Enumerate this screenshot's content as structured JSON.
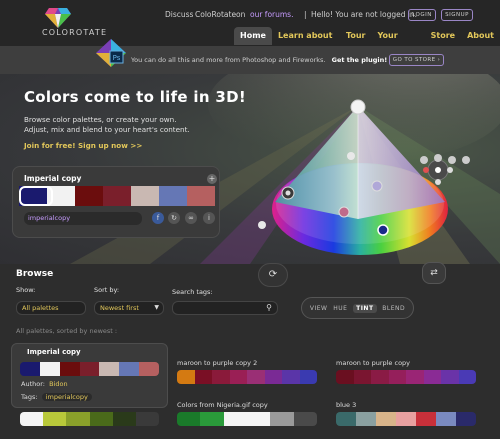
{
  "brand": {
    "logo_text": "COLOROTATE"
  },
  "header": {
    "discuss_prefix": "Discuss",
    "app_name": "ColoRotate",
    "on": "on",
    "forums_link": "our forums.",
    "greeting": "Hello! You are not logged in.",
    "login_label": "LOGIN",
    "signup_label": "SIGNUP"
  },
  "nav": {
    "tabs": [
      {
        "label": "Home",
        "active": true
      },
      {
        "label": "Learn about color",
        "active": false
      },
      {
        "label": "Tour",
        "active": false
      },
      {
        "label": "Your account",
        "active": false
      },
      {
        "label": "Store",
        "active": false
      },
      {
        "label": "About",
        "active": false
      }
    ]
  },
  "plugin_bar": {
    "text": "You can do all this and more from Photoshop and Fireworks.",
    "cta": "Get the plugin!",
    "store_button": "GO TO STORE",
    "icon_label": "Ps"
  },
  "hero": {
    "title": "Colors come to life in 3D!",
    "line1": "Browse color palettes, or create your own.",
    "line2": "Adjust, mix and blend to your heart's content.",
    "join_link": "Join for free! Sign up now >>"
  },
  "active_palette": {
    "name": "Imperial copy",
    "tag": "imperialcopy",
    "colors": [
      "#1a1a6e",
      "#f2f2f2",
      "#6b0d0d",
      "#7a1f2b",
      "#c9b8b2",
      "#6577b5",
      "#b56060"
    ]
  },
  "view_modes": [
    {
      "label": "VIEW",
      "active": false
    },
    {
      "label": "HUE",
      "active": false
    },
    {
      "label": "TINT",
      "active": true
    },
    {
      "label": "BLEND",
      "active": false
    }
  ],
  "browse": {
    "heading": "Browse",
    "show_label": "Show:",
    "show_value": "All palettes",
    "sort_label": "Sort by:",
    "sort_value": "Newest first",
    "search_label": "Search tags:",
    "search_value": "",
    "sort_line": "All palettes, sorted by newest :"
  },
  "results": [
    {
      "name": "Imperial copy",
      "author_label": "Author:",
      "author": "Bidon",
      "tags_label": "Tags:",
      "tags": "imperialcopy",
      "colors": [
        "#1a1a6e",
        "#f2f2f2",
        "#6b0d0d",
        "#7a1f2b",
        "#c9b8b2",
        "#6577b5",
        "#b56060"
      ]
    },
    {
      "name": "maroon to purple copy 2",
      "colors": [
        "#d47a12",
        "#7a0f25",
        "#8a1a3a",
        "#9a1f55",
        "#9a2f75",
        "#7a2a95",
        "#5a35a8",
        "#3a3ab0"
      ]
    },
    {
      "name": "maroon to purple copy",
      "colors": [
        "#6a0f20",
        "#7a1530",
        "#8a1b45",
        "#951f5b",
        "#9a2575",
        "#8a2b95",
        "#6a33a8",
        "#4a3ab5"
      ]
    },
    {
      "name": "",
      "colors": [
        "#f4f4f4",
        "#b8c83a",
        "#8aa02a",
        "#4a6a1a",
        "#2a3a1a",
        "#3a3a3a"
      ]
    },
    {
      "name": "Colors from Nigeria.gif copy",
      "colors": [
        "#1a7a2a",
        "#2a9a3a",
        "#f4f4f4",
        "#f4f4f4",
        "#9a9a9a",
        "#4a4a4a"
      ]
    },
    {
      "name": "blue 3",
      "colors": [
        "#3a6a6a",
        "#8aa0a0",
        "#d8b48a",
        "#e8a0a0",
        "#c8303a",
        "#7a8ac0",
        "#2a2a6a"
      ]
    }
  ],
  "colors": {
    "accent_gold": "#e2c75a",
    "accent_purple": "#c79cff",
    "background": "#2d2d2d"
  }
}
